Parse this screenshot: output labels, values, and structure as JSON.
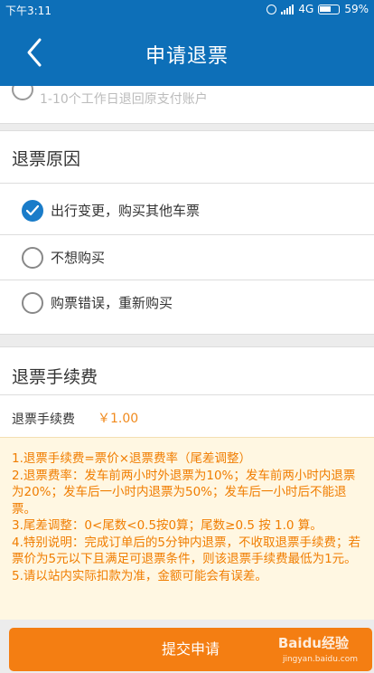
{
  "status_bar": {
    "time": "下午3:11",
    "network": "4G",
    "battery": "59%"
  },
  "header": {
    "title": "申请退票"
  },
  "refund_method": {
    "description": "1-10个工作日退回原支付账户"
  },
  "reason_section": {
    "title": "退票原因",
    "options": [
      {
        "label": "出行变更，购买其他车票",
        "selected": true
      },
      {
        "label": "不想购买",
        "selected": false
      },
      {
        "label": "购票错误，重新购买",
        "selected": false
      }
    ]
  },
  "fee_section": {
    "title": "退票手续费",
    "label": "退票手续费",
    "value": "￥1.00"
  },
  "notes": [
    "1.退票手续费=票价×退票费率（尾差调整）",
    "2.退票费率：发车前两小时外退票为10%；发车前两小时内退票为20%；发车后一小时内退票为50%；发车后一小时后不能退票。",
    "3.尾差调整：0<尾数<0.5按0算；尾数≥0.5 按 1.0 算。",
    "4.特别说明：完成订单后的5分钟内退票，不收取退票手续费；若票价为5元以下且满足可退票条件，则该退票手续费最低为1元。",
    "5.请以站内实际扣款为准，金额可能会有误差。"
  ],
  "footer": {
    "submit_label": "提交申请"
  },
  "watermark": {
    "brand": "Baidu经验",
    "url": "jingyan.baidu.com"
  },
  "colors": {
    "header": "#0d6fb8",
    "accent": "#f47e12",
    "notes_text": "#f07d00",
    "notes_bg": "#fff7e2",
    "radio_checked": "#1a7cc9"
  }
}
